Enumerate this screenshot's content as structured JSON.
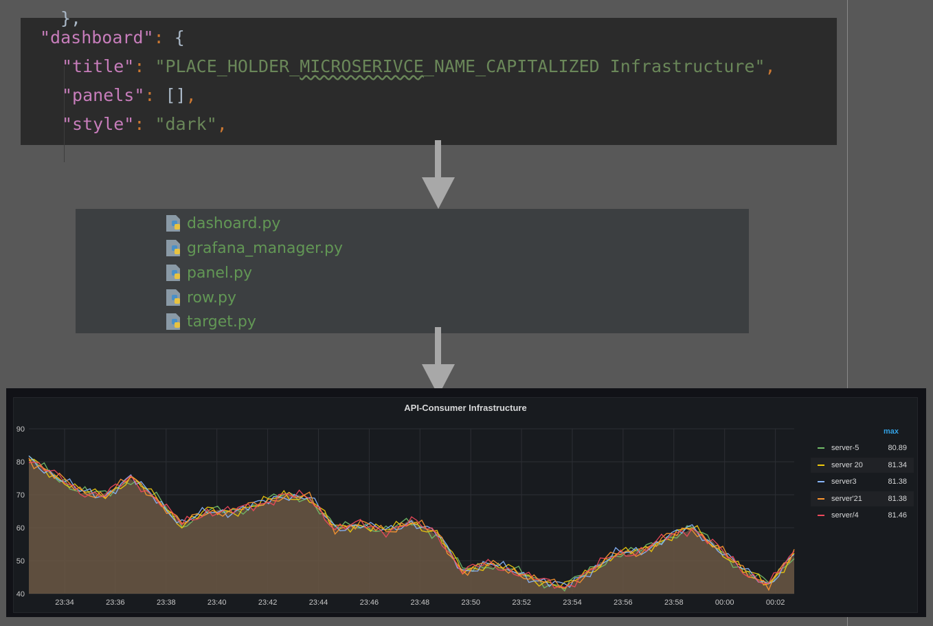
{
  "code": {
    "top_partial": "},",
    "line1": {
      "key": "\"dashboard\"",
      "colon": ":",
      "brace": " {"
    },
    "line2": {
      "key": "\"title\"",
      "colon": ":",
      "q1": " \"PLACE_HOLDER_",
      "sq": "MICROSERIVCE",
      "rest": "_NAME_CAPITALIZED Infrastructure\"",
      "comma": ","
    },
    "line3": {
      "key": "\"panels\"",
      "colon": ":",
      "val": " []",
      "comma": ","
    },
    "line4": {
      "key": "\"style\"",
      "colon": ":",
      "val": " \"dark\"",
      "comma": ","
    }
  },
  "files": [
    {
      "name": "dashoard.py",
      "icon": "python-file-icon"
    },
    {
      "name": "grafana_manager.py",
      "icon": "python-file-icon"
    },
    {
      "name": "panel.py",
      "icon": "python-file-icon"
    },
    {
      "name": "row.py",
      "icon": "python-file-icon"
    },
    {
      "name": "target.py",
      "icon": "python-file-icon"
    }
  ],
  "chart_data": {
    "type": "line",
    "title": "API-Consumer Infrastructure",
    "x_ticks": [
      "23:34",
      "23:36",
      "23:38",
      "23:40",
      "23:42",
      "23:44",
      "23:46",
      "23:48",
      "23:50",
      "23:52",
      "23:54",
      "23:56",
      "23:58",
      "00:00",
      "00:02"
    ],
    "y_ticks": [
      90,
      80,
      70,
      60,
      50,
      40
    ],
    "ylim": [
      40,
      90
    ],
    "x_minutes": [
      0,
      1,
      2,
      3,
      4,
      5,
      6,
      7,
      8,
      9,
      10,
      11,
      12,
      13,
      14,
      15,
      16,
      17,
      18,
      19,
      20,
      21,
      22,
      23,
      24,
      25,
      26,
      27,
      28,
      29,
      30
    ],
    "base_values": [
      81,
      76,
      71,
      70,
      75,
      69,
      61,
      65,
      65,
      67,
      70,
      69,
      60,
      61,
      59,
      62,
      58,
      47,
      49,
      47,
      44,
      42,
      47,
      52,
      53,
      57,
      60,
      54,
      47,
      43,
      52
    ],
    "legend_header": "max",
    "series": [
      {
        "name": "server-5",
        "color": "#73bf69",
        "max": "80.89"
      },
      {
        "name": "server 20",
        "color": "#f2cc0c",
        "max": "81.34"
      },
      {
        "name": "server3",
        "color": "#8ab8ff",
        "max": "81.38"
      },
      {
        "name": "server'21",
        "color": "#ff9830",
        "max": "81.38"
      },
      {
        "name": "server/4",
        "color": "#f2495c",
        "max": "81.46"
      }
    ],
    "fill_color": "#6b5744",
    "grid": true,
    "legend_position": "right"
  }
}
